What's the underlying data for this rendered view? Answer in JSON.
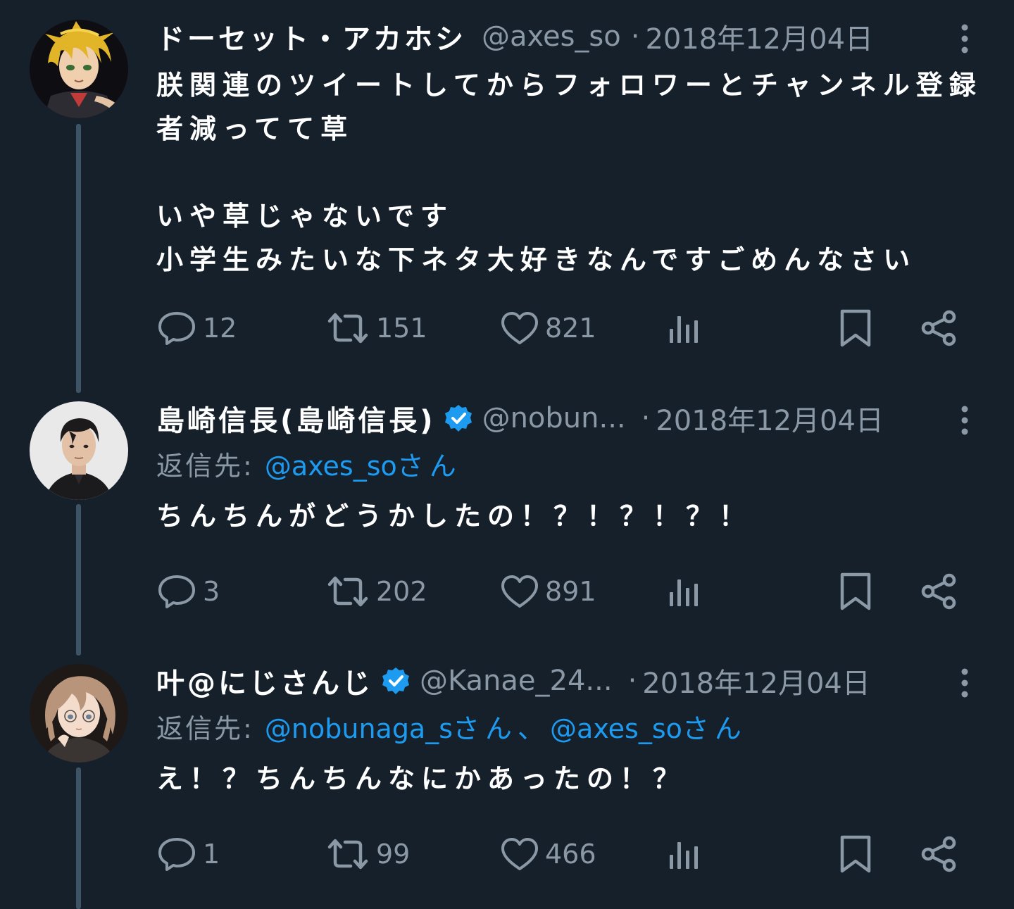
{
  "colors": {
    "background": "#15202b",
    "text_primary": "#ffffff",
    "text_secondary": "#8b98a5",
    "link": "#1d9bf0",
    "verified_badge": "#1d9bf0",
    "thread_line": "#3d5466"
  },
  "tweets": [
    {
      "display_name": "ドーセット・アカホシ",
      "handle": "@axes_so",
      "dot": "·",
      "date": "2018年12月04日",
      "verified": false,
      "body": "朕関連のツイートしてからフォロワーとチャンネル登録\n者減ってて草\n\nいや草じゃないです\n小学生みたいな下ネタ大好きなんですごめんなさい",
      "stats": {
        "replies": "12",
        "retweets": "151",
        "likes": "821"
      },
      "icons": [
        "reply-icon",
        "retweet-icon",
        "like-icon",
        "views-icon",
        "bookmark-icon",
        "share-icon",
        "more-icon"
      ]
    },
    {
      "display_name": "島崎信長(島崎信長)",
      "handle": "@nobun...",
      "dot": "·",
      "date": "2018年12月04日",
      "verified": true,
      "reply_prefix": "返信先:",
      "reply_mentions": [
        {
          "mention": "@axes_so",
          "suffix": "さん"
        }
      ],
      "body": "ちんちんがどうかしたの！？！？！？！",
      "stats": {
        "replies": "3",
        "retweets": "202",
        "likes": "891"
      }
    },
    {
      "display_name": "叶@にじさんじ",
      "handle": "@Kanae_24...",
      "dot": "·",
      "date": "2018年12月04日",
      "verified": true,
      "reply_prefix": "返信先:",
      "reply_mentions": [
        {
          "mention": "@nobunaga_s",
          "suffix": "さん、"
        },
        {
          "mention": "@axes_so",
          "suffix": "さん"
        }
      ],
      "body": "え！？ちんちんなにかあったの！？",
      "stats": {
        "replies": "1",
        "retweets": "99",
        "likes": "466"
      }
    }
  ]
}
